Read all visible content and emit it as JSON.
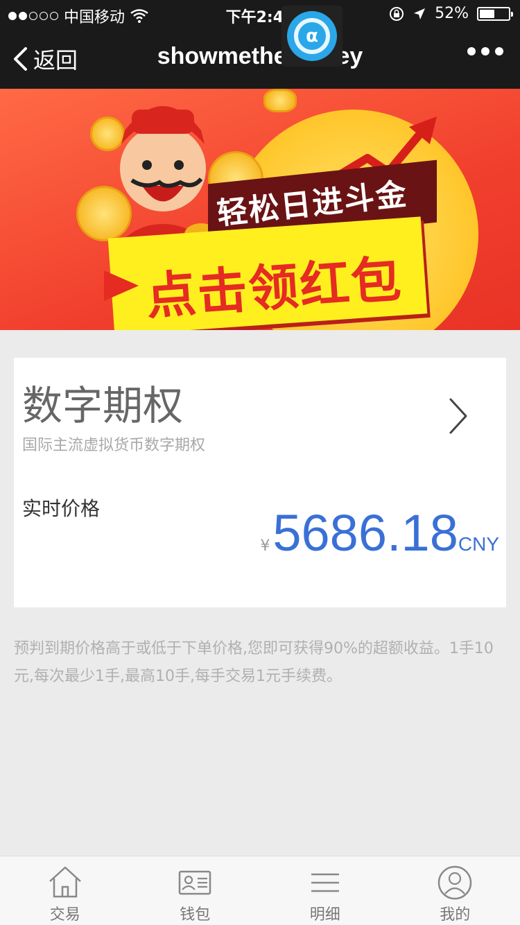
{
  "status_bar": {
    "carrier": "中国移动",
    "time": "下午2:49",
    "battery": "52%",
    "battery_level": 0.52
  },
  "nav": {
    "back_label": "返回",
    "title": "showmethemoney"
  },
  "banner": {
    "slogan_top": "轻松日进斗金",
    "slogan_main": "点击领红包"
  },
  "card": {
    "title": "数字期权",
    "subtitle": "国际主流虚拟货币数字期权",
    "price_label": "实时价格",
    "currency_symbol": "¥",
    "price": "5686.18",
    "unit": "CNY"
  },
  "description": "预判到期价格高于或低于下单价格,您即可获得90%的超额收益。1手10元,每次最少1手,最高10手,每手交易1元手续费。",
  "tabs": [
    {
      "label": "交易",
      "icon": "home-icon"
    },
    {
      "label": "钱包",
      "icon": "wallet-card-icon"
    },
    {
      "label": "明细",
      "icon": "list-icon"
    },
    {
      "label": "我的",
      "icon": "user-icon"
    }
  ],
  "colors": {
    "price_blue": "#3a70d6",
    "nav_bg": "#1a1a1a",
    "banner_red": "#f13f2d"
  }
}
